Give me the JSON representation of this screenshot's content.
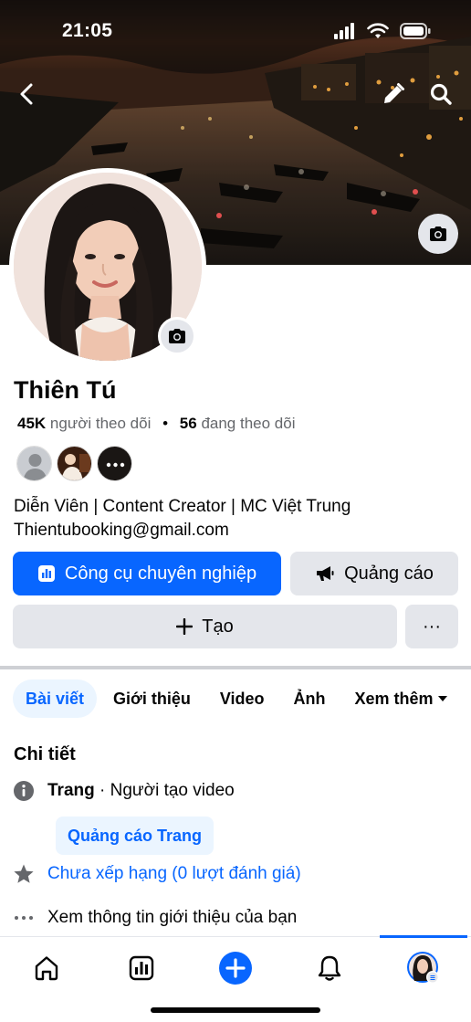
{
  "status_bar": {
    "time": "21:05"
  },
  "profile": {
    "name": "Thiên Tú",
    "followers_count": "45K",
    "followers_label": "người theo dõi",
    "following_count": "56",
    "following_label": "đang theo dõi",
    "bio_line1": "Diễn Viên | Content Creator | MC Việt Trung",
    "bio_line2": "Thientubooking@gmail.com"
  },
  "actions": {
    "professional_tools": "Công cụ chuyên nghiệp",
    "ads": "Quảng cáo",
    "create": "Tạo",
    "more": "···"
  },
  "tabs": [
    {
      "label": "Bài viết",
      "active": true
    },
    {
      "label": "Giới thiệu",
      "active": false
    },
    {
      "label": "Video",
      "active": false
    },
    {
      "label": "Ảnh",
      "active": false
    },
    {
      "label": "Xem thêm",
      "active": false
    }
  ],
  "details": {
    "title": "Chi tiết",
    "page_type_bold": "Trang",
    "page_type_rest": " · Người tạo video",
    "promote_page": "Quảng cáo Trang",
    "rating": "Chưa xếp hạng (0 lượt đánh giá)",
    "about": "Xem thông tin giới thiệu của bạn"
  },
  "colors": {
    "accent": "#0866ff",
    "button_grey": "#e4e6eb",
    "text_secondary": "#65676b"
  },
  "icons": [
    "back-icon",
    "edit-pencil-icon",
    "search-icon",
    "camera-icon",
    "dashboard-icon",
    "megaphone-icon",
    "plus-icon",
    "info-icon",
    "star-icon",
    "dots-icon",
    "home-icon",
    "analytics-icon",
    "create-plus-icon",
    "bell-icon"
  ]
}
